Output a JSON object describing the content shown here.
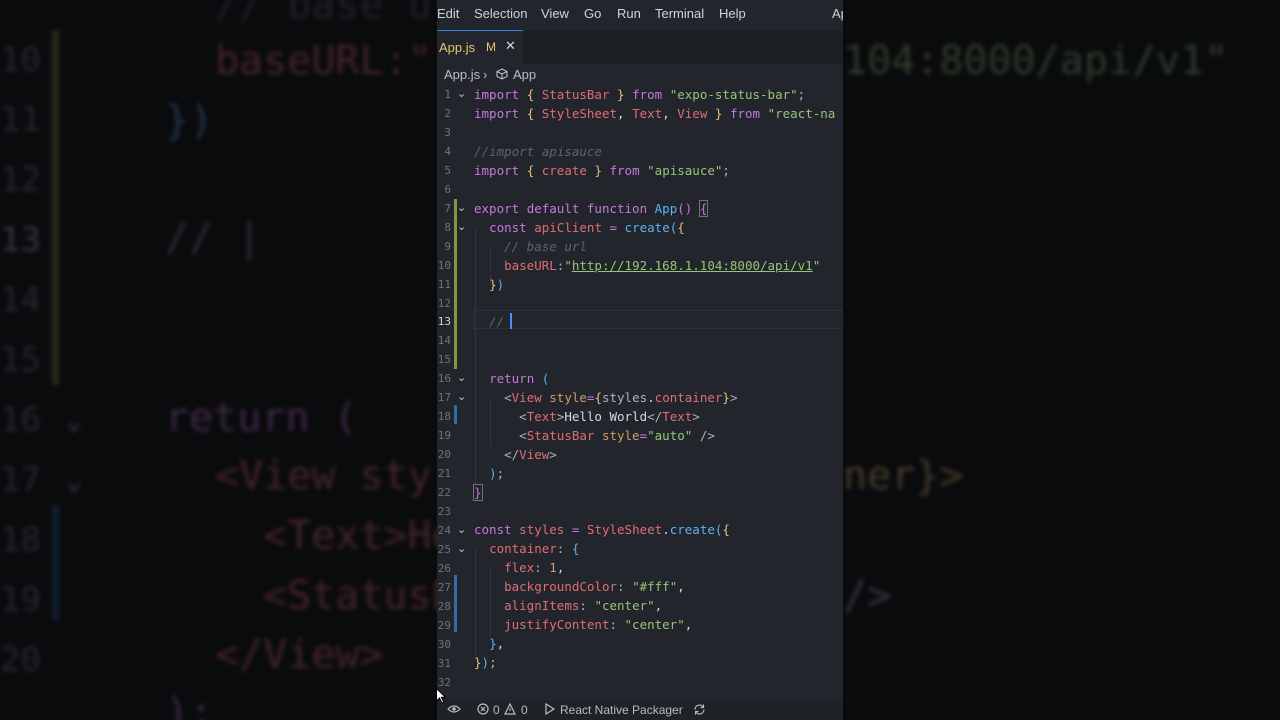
{
  "menu": {
    "items": [
      "Edit",
      "Selection",
      "View",
      "Go",
      "Run",
      "Terminal",
      "Help"
    ],
    "truncated": "Ap"
  },
  "tab": {
    "name": "App.js",
    "modified": "M",
    "close": "✕"
  },
  "breadcrumb": {
    "file": "App.js",
    "separator": "›",
    "symbol": "App"
  },
  "code": {
    "line_numbers": [
      "1",
      "2",
      "3",
      "4",
      "5",
      "6",
      "7",
      "8",
      "9",
      "10",
      "11",
      "12",
      "13",
      "14",
      "15",
      "16",
      "17",
      "18",
      "19",
      "20",
      "21",
      "22",
      "23",
      "24",
      "25",
      "26",
      "27",
      "28",
      "29",
      "30",
      "31",
      "32"
    ],
    "lines": [
      "import { StatusBar } from \"expo-status-bar\";",
      "import { StyleSheet, Text, View } from \"react-na",
      "",
      "//import apisauce",
      "import { create } from \"apisauce\";",
      "",
      "export default function App() {",
      "  const apiClient = create({",
      "    // base url",
      "    baseURL:\"http://192.168.1.104:8000/api/v1\"",
      "  })",
      "",
      "  // ",
      "",
      "",
      "  return (",
      "    <View style={styles.container}>",
      "      <Text>Hello World</Text>",
      "      <StatusBar style=\"auto\" />",
      "    </View>",
      "  );",
      "}",
      "",
      "const styles = StyleSheet.create({",
      "  container: {",
      "    flex: 1,",
      "    backgroundColor: \"#fff\",",
      "    alignItems: \"center\",",
      "    justifyContent: \"center\",",
      "  },",
      "});",
      ""
    ],
    "active_line": 13,
    "fold_lines": [
      1,
      7,
      8,
      16,
      17,
      24,
      25
    ]
  },
  "status": {
    "errors": "0",
    "warnings": "0",
    "packager": "React Native Packager"
  },
  "background": {
    "line_numbers": [
      "10",
      "11",
      "12",
      "13",
      "14",
      "15",
      "16",
      "17",
      "18",
      "19",
      "20"
    ],
    "snippets": [
      "// base ur",
      "baseURL:\"",
      "104:8000/api/v1\"",
      "})",
      "// |",
      "return (",
      "<View sty",
      "ner}>",
      "<Text>He",
      "<StatusB",
      "/>",
      "</View>",
      ");"
    ]
  },
  "colors": {
    "editor_bg": "#22262c",
    "keyword": "#c678dd",
    "function": "#5fb0f2",
    "string": "#98c379",
    "property": "#e06c75",
    "number": "#d19a66",
    "comment": "#5c6370",
    "accent": "#2f82e0",
    "modified": "#e8c76e"
  },
  "icons": [
    "close-icon",
    "js-file-icon",
    "symbol-icon",
    "chevron-down-icon",
    "remote-icon",
    "error-icon",
    "warning-icon",
    "run-icon",
    "sync-icon",
    "mouse-pointer-icon"
  ]
}
